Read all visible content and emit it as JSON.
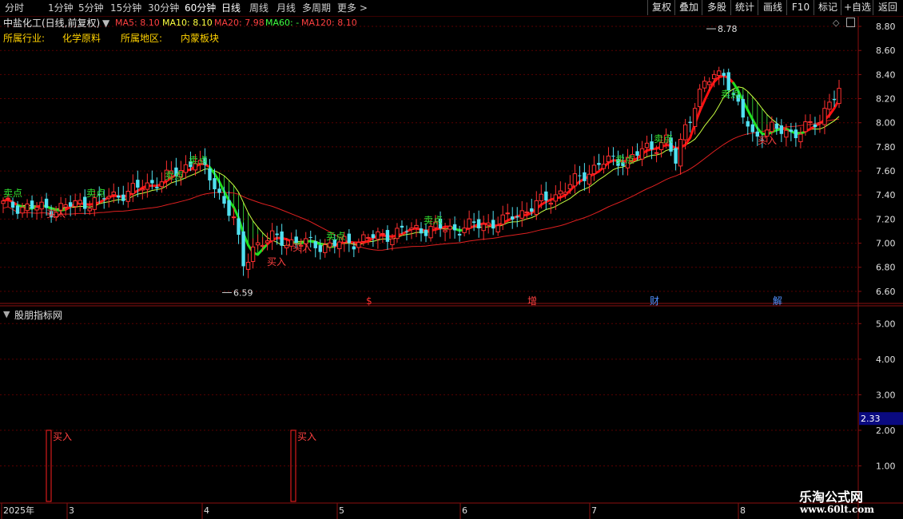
{
  "toolbar": {
    "periods": [
      {
        "label": "分时",
        "active": false
      },
      {
        "label": "1分钟",
        "active": false
      },
      {
        "label": "5分钟",
        "active": false
      },
      {
        "label": "15分钟",
        "active": false
      },
      {
        "label": "30分钟",
        "active": false
      },
      {
        "label": "60分钟",
        "active": false
      },
      {
        "label": "日线",
        "active": true
      },
      {
        "label": "周线",
        "active": false
      },
      {
        "label": "月线",
        "active": false
      },
      {
        "label": "多周期",
        "active": false
      },
      {
        "label": "更多 >",
        "active": false
      }
    ],
    "right_buttons": [
      "复权",
      "叠加",
      "多股",
      "统计",
      "画线",
      "F10",
      "标记",
      "+自选",
      "返回"
    ]
  },
  "title": {
    "stock": "中盐化工(日线,前复权)",
    "ma": [
      {
        "label": "MA5: 8.10",
        "color": "#ff4040"
      },
      {
        "label": "MA10: 8.10",
        "color": "#ffff40"
      },
      {
        "label": "MA20: 7.98",
        "color": "#ff4040"
      },
      {
        "label": "MA60: -",
        "color": "#40ff40"
      },
      {
        "label": "MA120: 8.10",
        "color": "#ff4040"
      }
    ]
  },
  "info": {
    "industry_label": "所属行业:",
    "industry": "化学原料",
    "region_label": "所属地区:",
    "region": "内蒙板块"
  },
  "main_axis": {
    "ticks": [
      "8.80",
      "8.60",
      "8.40",
      "8.20",
      "8.00",
      "7.80",
      "7.60",
      "7.40",
      "7.20",
      "7.00",
      "6.80",
      "6.60"
    ]
  },
  "sub_axis": {
    "ticks": [
      "5.00",
      "4.00",
      "3.00",
      "2.00",
      "1.00"
    ],
    "current": "2.33"
  },
  "indicator_name": "股朋指标网",
  "date_axis": {
    "labels": [
      "2025年",
      "3",
      "4",
      "5",
      "6",
      "7",
      "8"
    ]
  },
  "price_markers": {
    "high": "8.78",
    "low": "6.59"
  },
  "event_markers": [
    "$",
    "增",
    "财",
    "解"
  ],
  "signal_labels": {
    "buy": "买入",
    "sell": "卖点"
  },
  "watermark": {
    "title": "乐淘公式网",
    "url": "www.60lt.com"
  },
  "chart_data": {
    "type": "candlestick",
    "price_range": [
      6.5,
      8.86
    ],
    "high": 8.78,
    "low": 6.59,
    "indicator_range": [
      0,
      5.5
    ],
    "buy_signal_values": [
      2.0,
      2.0
    ]
  }
}
